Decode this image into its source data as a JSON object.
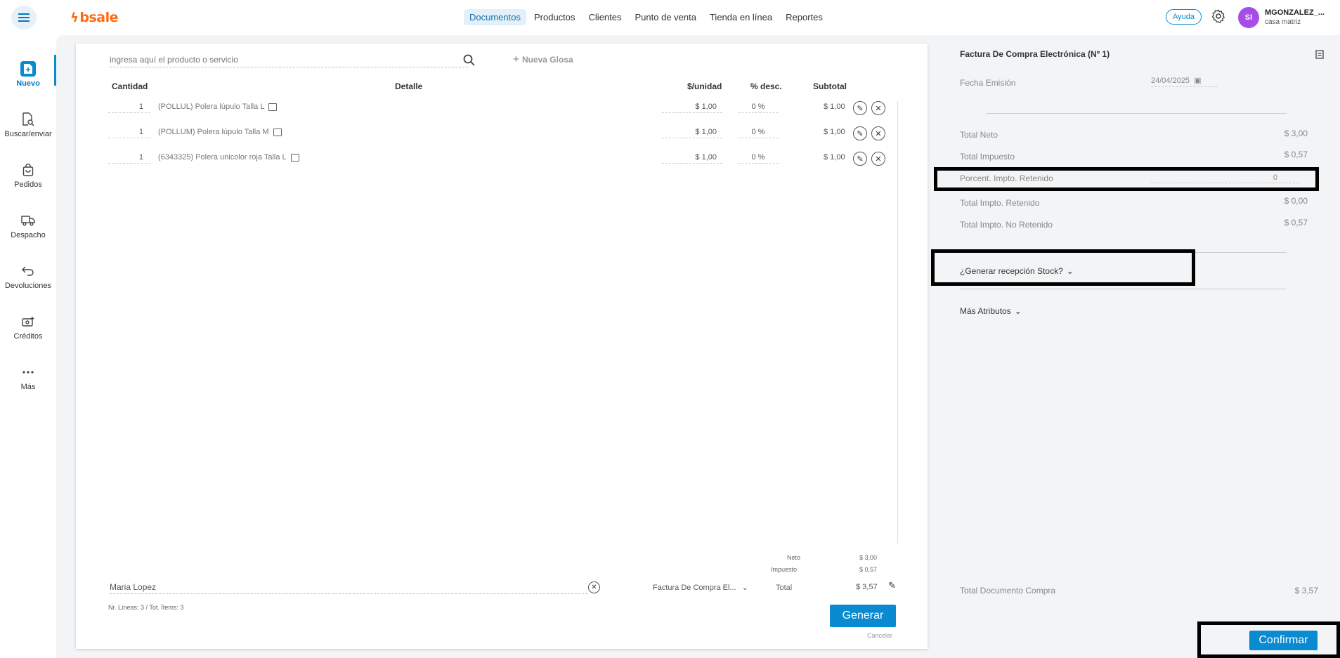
{
  "topbar": {
    "logo": "bsale",
    "nav": [
      "Documentos",
      "Productos",
      "Clientes",
      "Punto de venta",
      "Tienda en línea",
      "Reportes"
    ],
    "active_nav": "Documentos",
    "help": "Ayuda",
    "avatar_initials": "SI",
    "user_name": "MGONZALEZ_...",
    "user_branch": "casa matriz"
  },
  "sidebar": {
    "items": [
      {
        "label": "Nuevo",
        "icon": "new-doc-icon",
        "active": true
      },
      {
        "label": "Buscar/enviar",
        "icon": "search-doc-icon",
        "active": false
      },
      {
        "label": "Pedidos",
        "icon": "bag-icon",
        "active": false
      },
      {
        "label": "Despacho",
        "icon": "truck-icon",
        "active": false
      },
      {
        "label": "Devoluciones",
        "icon": "return-icon",
        "active": false
      },
      {
        "label": "Créditos",
        "icon": "credit-icon",
        "active": false
      },
      {
        "label": "Más",
        "icon": "more-icon",
        "active": false
      }
    ]
  },
  "document": {
    "search_placeholder": "ingresa aquí el producto o servicio",
    "new_gloss": "Nueva Glosa",
    "columns": {
      "qty": "Cantidad",
      "detail": "Detalle",
      "unit_price": "$/unidad",
      "discount": "% desc.",
      "subtotal": "Subtotal"
    },
    "rows": [
      {
        "qty": "1",
        "detail": "(POLLUL) Polera lúpulo Talla L",
        "unit_price": "$ 1,00",
        "discount": "0 %",
        "subtotal": "$ 1,00"
      },
      {
        "qty": "1",
        "detail": "(POLLUM) Polera lúpulo Talla M",
        "unit_price": "$ 1,00",
        "discount": "0 %",
        "subtotal": "$ 1,00"
      },
      {
        "qty": "1",
        "detail": "(6343325) Polera unicolor roja Talla L",
        "unit_price": "$ 1,00",
        "discount": "0 %",
        "subtotal": "$ 1,00"
      }
    ],
    "totals": {
      "neto_label": "Neto",
      "neto": "$ 3,00",
      "impuesto_label": "Impuesto",
      "impuesto": "$ 0,57",
      "total_label": "Total",
      "total": "$ 3,57"
    },
    "contact": "Maria Lopez",
    "doc_type": "Factura De Compra El...",
    "lines_info": "Nr. Líneas: 3 / Tot. Ítems: 3",
    "generate": "Generar",
    "cancel": "Cancelar"
  },
  "summary": {
    "title": "Factura De Compra Electrónica (Nº 1)",
    "fecha_label": "Fecha Emisión",
    "fecha_value": "24/04/2025",
    "total_neto_label": "Total Neto",
    "total_neto": "$ 3,00",
    "total_impuesto_label": "Total Impuesto",
    "total_impuesto": "$ 0,57",
    "porcent_label": "Porcent. Impto. Retenido",
    "porcent_value": "0",
    "total_retenido_label": "Total Impto. Retenido",
    "total_retenido": "$ 0,00",
    "total_no_retenido_label": "Total Impto. No Retenido",
    "total_no_retenido": "$ 0,57",
    "stock_toggle": "¿Generar recepción Stock?",
    "more_attrs": "Más Atributos",
    "total_doc_label": "Total Documento Compra",
    "total_doc": "$ 3,57",
    "confirm": "Confirmar"
  },
  "colors": {
    "accent": "#0a8ad0",
    "brand": "#ff6a13",
    "avatar": "#a64de8"
  }
}
